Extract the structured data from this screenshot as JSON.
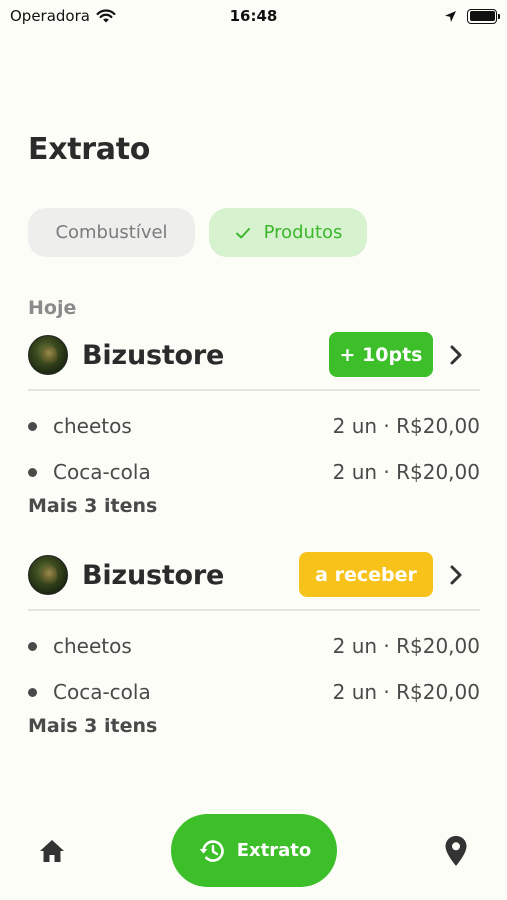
{
  "status_bar": {
    "carrier": "Operadora",
    "time": "16:48"
  },
  "page_title": "Extrato",
  "tabs": [
    {
      "label": "Combustível",
      "active": false
    },
    {
      "label": "Produtos",
      "active": true
    }
  ],
  "section_label": "Hoje",
  "orders": [
    {
      "store": "Bizustore",
      "badge": "+ 10pts",
      "badge_type": "points",
      "items": [
        {
          "name": "cheetos",
          "detail": "2 un · R$20,00"
        },
        {
          "name": "Coca-cola",
          "detail": "2 un · R$20,00"
        }
      ],
      "more": "Mais 3 itens"
    },
    {
      "store": "Bizustore",
      "badge": "a receber",
      "badge_type": "pending",
      "items": [
        {
          "name": "cheetos",
          "detail": "2 un · R$20,00"
        },
        {
          "name": "Coca-cola",
          "detail": "2 un · R$20,00"
        }
      ],
      "more": "Mais 3 itens"
    }
  ],
  "bottom_nav": {
    "home_icon": "home-icon",
    "extrato_label": "Extrato",
    "location_icon": "location-pin-icon"
  },
  "colors": {
    "accent_green": "#3dbf2a",
    "active_tab_bg": "#d7f2ce",
    "pending_yellow": "#f7c21a",
    "background": "#fdfdf8"
  }
}
